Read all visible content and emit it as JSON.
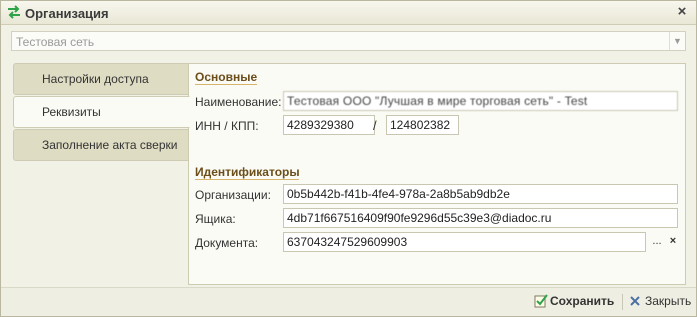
{
  "window": {
    "title": "Организация"
  },
  "organization_select": {
    "value": "Тестовая сеть"
  },
  "tabs": [
    {
      "label": "Настройки доступа",
      "active": false
    },
    {
      "label": "Реквизиты",
      "active": true
    },
    {
      "label": "Заполнение акта сверки",
      "active": false
    }
  ],
  "main_section": {
    "title": "Основные",
    "name_label": "Наименование:",
    "name_value": "Тестовая ООО \"Лучшая в мире торговая сеть\" - Test",
    "inn_kpp_label": "ИНН / КПП:",
    "inn_value": "4289329380",
    "kpp_separator": "/",
    "kpp_value": "124802382"
  },
  "identifiers_section": {
    "title": "Идентификаторы",
    "org_label": "Организации:",
    "org_value": "0b5b442b-f41b-4fe4-978a-2a8b5ab9db2e",
    "box_label": "Ящика:",
    "box_value": "4db71f667516409f90fe9296d55c39e3@diadoc.ru",
    "doc_label": "Документа:",
    "doc_value": "637043247529609903",
    "select_button": "...",
    "clear_button": "×"
  },
  "footer": {
    "save_label": "Сохранить",
    "close_label": "Закрыть"
  },
  "icons": {
    "app": "transfer-arrows-icon",
    "close": "close-icon",
    "save": "save-check-icon",
    "close_footer": "close-x-icon"
  },
  "colors": {
    "section_title": "#6b4e1a",
    "section_line": "#d6b46d",
    "app_icon": "#2ea34a"
  }
}
